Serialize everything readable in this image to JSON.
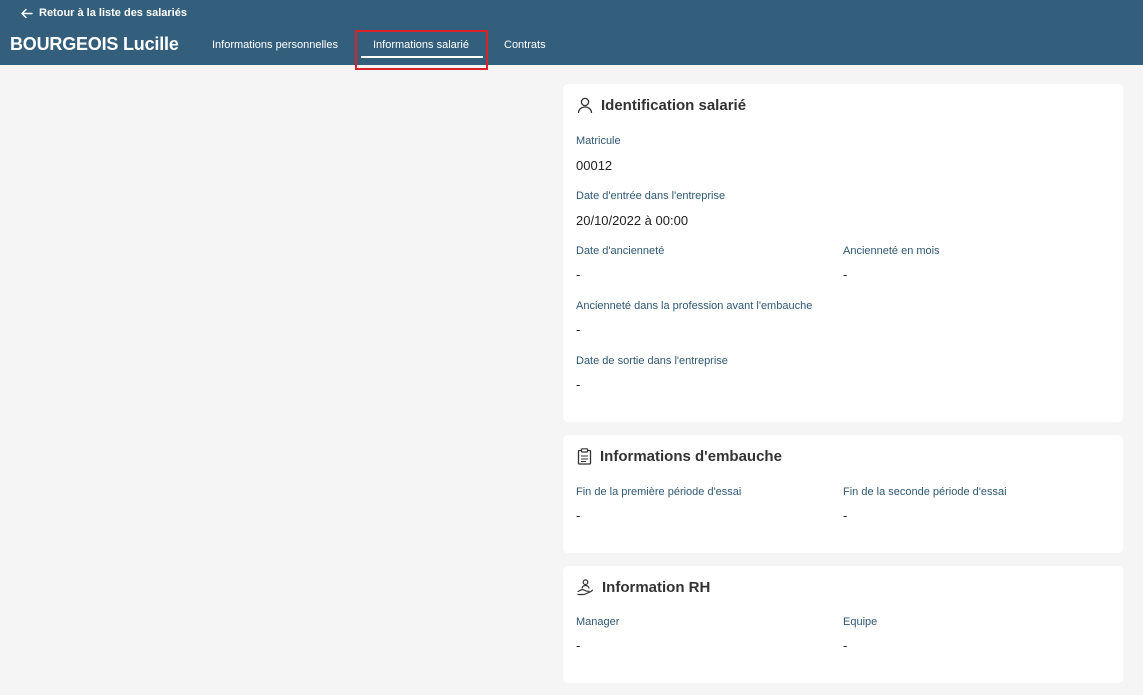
{
  "header": {
    "back_label": "Retour à la liste des salariés",
    "employee_name": "BOURGEOIS Lucille",
    "tabs": [
      {
        "label": "Informations personnelles",
        "active": false
      },
      {
        "label": "Informations salarié",
        "active": true
      },
      {
        "label": "Contrats",
        "active": false
      }
    ]
  },
  "identification": {
    "title": "Identification salarié",
    "icon": "person-icon",
    "matricule_label": "Matricule",
    "matricule_value": "00012",
    "date_entree_label": "Date d'entrée dans l'entreprise",
    "date_entree_value": "20/10/2022 à 00:00",
    "date_anciennete_label": "Date d'ancienneté",
    "date_anciennete_value": "-",
    "anciennete_mois_label": "Ancienneté en mois",
    "anciennete_mois_value": "-",
    "anciennete_profession_label": "Ancienneté dans la profession avant l'embauche",
    "anciennete_profession_value": "-",
    "date_sortie_label": "Date de sortie dans l'entreprise",
    "date_sortie_value": "-"
  },
  "embauche": {
    "title": "Informations d'embauche",
    "icon": "clipboard-icon",
    "fin_premiere_label": "Fin de la première période d'essai",
    "fin_premiere_value": "-",
    "fin_seconde_label": "Fin de la seconde période d'essai",
    "fin_seconde_value": "-"
  },
  "rh": {
    "title": "Information RH",
    "icon": "hand-person-icon",
    "manager_label": "Manager",
    "manager_value": "-",
    "equipe_label": "Equipe",
    "equipe_value": "-"
  },
  "colors": {
    "header_bg": "#345f7c",
    "label_color": "#2f5872",
    "highlight": "#d8232a",
    "page_bg": "#f5f5f5"
  }
}
